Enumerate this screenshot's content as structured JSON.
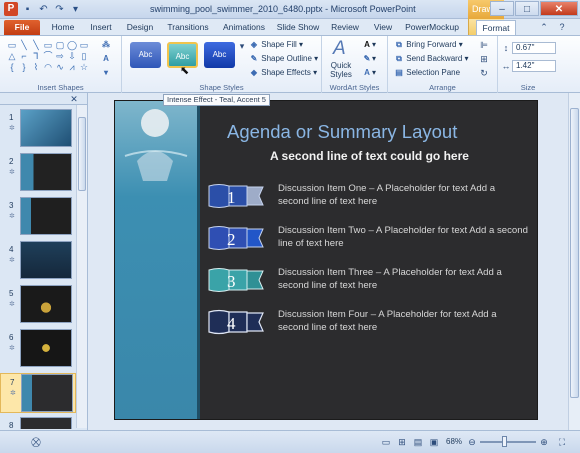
{
  "window": {
    "title": "swimming_pool_swimmer_2010_6480.pptx - Microsoft PowerPoint",
    "contextual_header": "Draw...",
    "app_logo": "P",
    "qat_icons": [
      "save-icon",
      "undo-icon",
      "redo-icon",
      "customize-icon"
    ]
  },
  "tabs": [
    "File",
    "Home",
    "Insert",
    "Design",
    "Transitions",
    "Animations",
    "Slide Show",
    "Review",
    "View",
    "PowerMockup",
    "Format"
  ],
  "ribbon": {
    "groups": {
      "insert_shapes": "Insert Shapes",
      "shape_styles": "Shape Styles",
      "wordart_styles": "WordArt Styles",
      "arrange": "Arrange",
      "size": "Size"
    },
    "style_swatches": [
      "Abc",
      "Abc",
      "Abc"
    ],
    "shape_buttons": {
      "fill": "Shape Fill",
      "outline": "Shape Outline",
      "effects": "Shape Effects"
    },
    "quick_styles": "Quick Styles",
    "arrange_buttons": {
      "bring_forward": "Bring Forward",
      "send_backward": "Send Backward",
      "selection_pane": "Selection Pane"
    },
    "size": {
      "height": "0.67\"",
      "width": "1.42\""
    },
    "tooltip": "Intense Effect - Teal, Accent 5"
  },
  "thumbnails": {
    "numbers": [
      "1",
      "2",
      "3",
      "4",
      "5",
      "6",
      "7",
      "8"
    ],
    "selected_index": 7
  },
  "slide": {
    "title": "Agenda or Summary Layout",
    "subtitle": "A second line of text could go here",
    "items": [
      {
        "number": "1",
        "text": "Discussion Item One – A Placeholder for text  Add a second line of text here"
      },
      {
        "number": "2",
        "text": "Discussion Item Two – A Placeholder for text  Add a second line of text here"
      },
      {
        "number": "3",
        "text": "Discussion Item Three  – A Placeholder for text  Add a second line of text here"
      },
      {
        "number": "4",
        "text": "Discussion Item Four – A Placeholder for text  Add a second line of text here"
      }
    ]
  },
  "status": {
    "zoom": "68%"
  },
  "colors": {
    "file_tab": "#d24726",
    "slide_bg": "#2c2c2e",
    "title_blue": "#8ab6e4",
    "teal_band": "#3c8fb2"
  }
}
